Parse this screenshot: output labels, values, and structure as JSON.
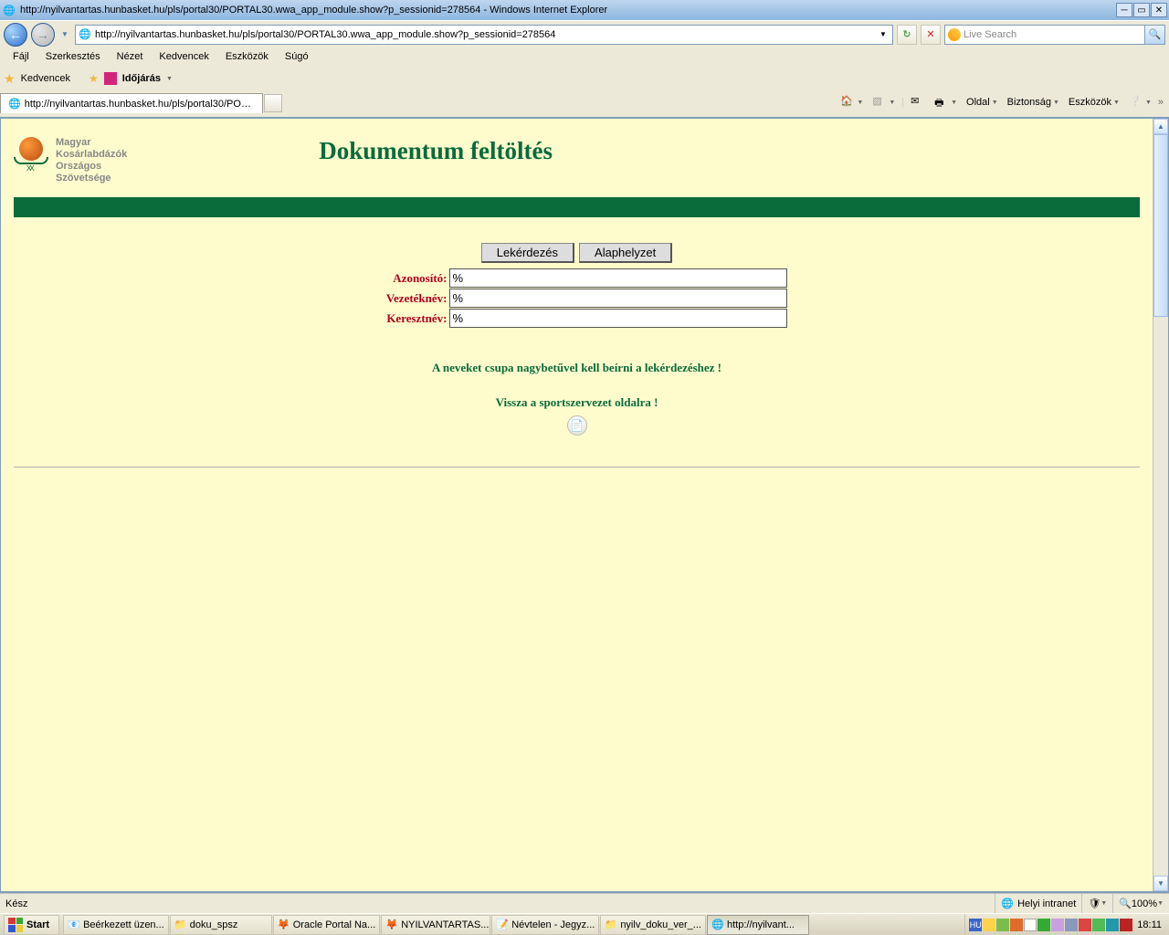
{
  "window": {
    "title": "http://nyilvantartas.hunbasket.hu/pls/portal30/PORTAL30.wwa_app_module.show?p_sessionid=278564 - Windows Internet Explorer"
  },
  "address": {
    "url": "http://nyilvantartas.hunbasket.hu/pls/portal30/PORTAL30.wwa_app_module.show?p_sessionid=278564"
  },
  "search": {
    "placeholder": "Live Search"
  },
  "menus": [
    "Fájl",
    "Szerkesztés",
    "Nézet",
    "Kedvencek",
    "Eszközök",
    "Súgó"
  ],
  "favbar": {
    "label": "Kedvencek",
    "item": "Időjárás"
  },
  "tab": {
    "title": "http://nyilvantartas.hunbasket.hu/pls/portal30/PORT..."
  },
  "cmd": {
    "page": "Oldal",
    "safety": "Biztonság",
    "tools": "Eszközök"
  },
  "org": {
    "l1": "Magyar",
    "l2": "Kosárlabdázók",
    "l3": "Országos",
    "l4": "Szövetsége"
  },
  "page": {
    "title": "Dokumentum feltöltés",
    "btn_query": "Lekérdezés",
    "btn_reset": "Alaphelyzet",
    "label_id": "Azonosító:",
    "label_last": "Vezetéknév:",
    "label_first": "Keresztnév:",
    "val_id": "%",
    "val_last": "%",
    "val_first": "%",
    "hint": "A neveket csupa nagybetűvel kell beírni a lekérdezéshez !",
    "back": "Vissza a sportszervezet oldalra !"
  },
  "status": {
    "ready": "Kész",
    "zone": "Helyi intranet",
    "zoom": "100%"
  },
  "taskbar": {
    "start": "Start",
    "tasks": [
      {
        "t": "Beérkezett üzen..."
      },
      {
        "t": "doku_spsz"
      },
      {
        "t": "Oracle Portal Na..."
      },
      {
        "t": "NYILVANTARTAS..."
      },
      {
        "t": "Névtelen - Jegyz..."
      },
      {
        "t": "nyilv_doku_ver_..."
      },
      {
        "t": "http://nyilvant...",
        "active": true
      }
    ],
    "lang": "HU",
    "clock": "18:11"
  }
}
